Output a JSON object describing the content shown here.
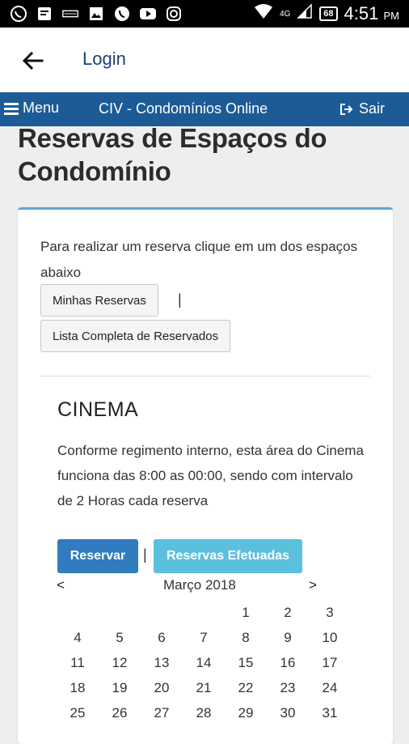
{
  "status_bar": {
    "network": "4G",
    "battery": "68",
    "time": "4:51",
    "ampm": "PM",
    "icons": [
      "whatsapp-icon",
      "message-icon",
      "notification-icon",
      "gallery-icon",
      "phone-icon",
      "youtube-icon",
      "instagram-icon",
      "wifi-icon",
      "signal-icon",
      "battery-icon"
    ]
  },
  "app_bar": {
    "title": "Login",
    "back_icon": "arrow-left-icon"
  },
  "navbar": {
    "menu_label": "Menu",
    "site_title": "CIV - Condomínios Online",
    "exit_label": "Sair",
    "color": "#1c5b96"
  },
  "page": {
    "title": "Reservas de Espaços do Condomínio",
    "intro": "Para realizar um reserva clique em um dos espaços abaixo",
    "my_reservations_label": "Minhas Reservas",
    "pipe": "|",
    "full_list_label": "Lista Completa de Reservados"
  },
  "space": {
    "name": "CINEMA",
    "description": "Conforme regimento interno, esta área do Cinema funciona das 8:00 as 00:00, sendo com intervalo de 2 Horas cada reserva",
    "reserve_label": "Reservar",
    "pipe": "|",
    "done_label": "Reservas Efetuadas",
    "primary_color": "#2f7cc0",
    "info_color": "#5bc0de"
  },
  "calendar": {
    "prev": "<",
    "next": ">",
    "month": "Março 2018",
    "days": [
      "",
      "",
      "",
      "",
      "1",
      "2",
      "3",
      "4",
      "5",
      "6",
      "7",
      "8",
      "9",
      "10",
      "11",
      "12",
      "13",
      "14",
      "15",
      "16",
      "17",
      "18",
      "19",
      "20",
      "21",
      "22",
      "23",
      "24",
      "25",
      "26",
      "27",
      "28",
      "29",
      "30",
      "31"
    ]
  }
}
